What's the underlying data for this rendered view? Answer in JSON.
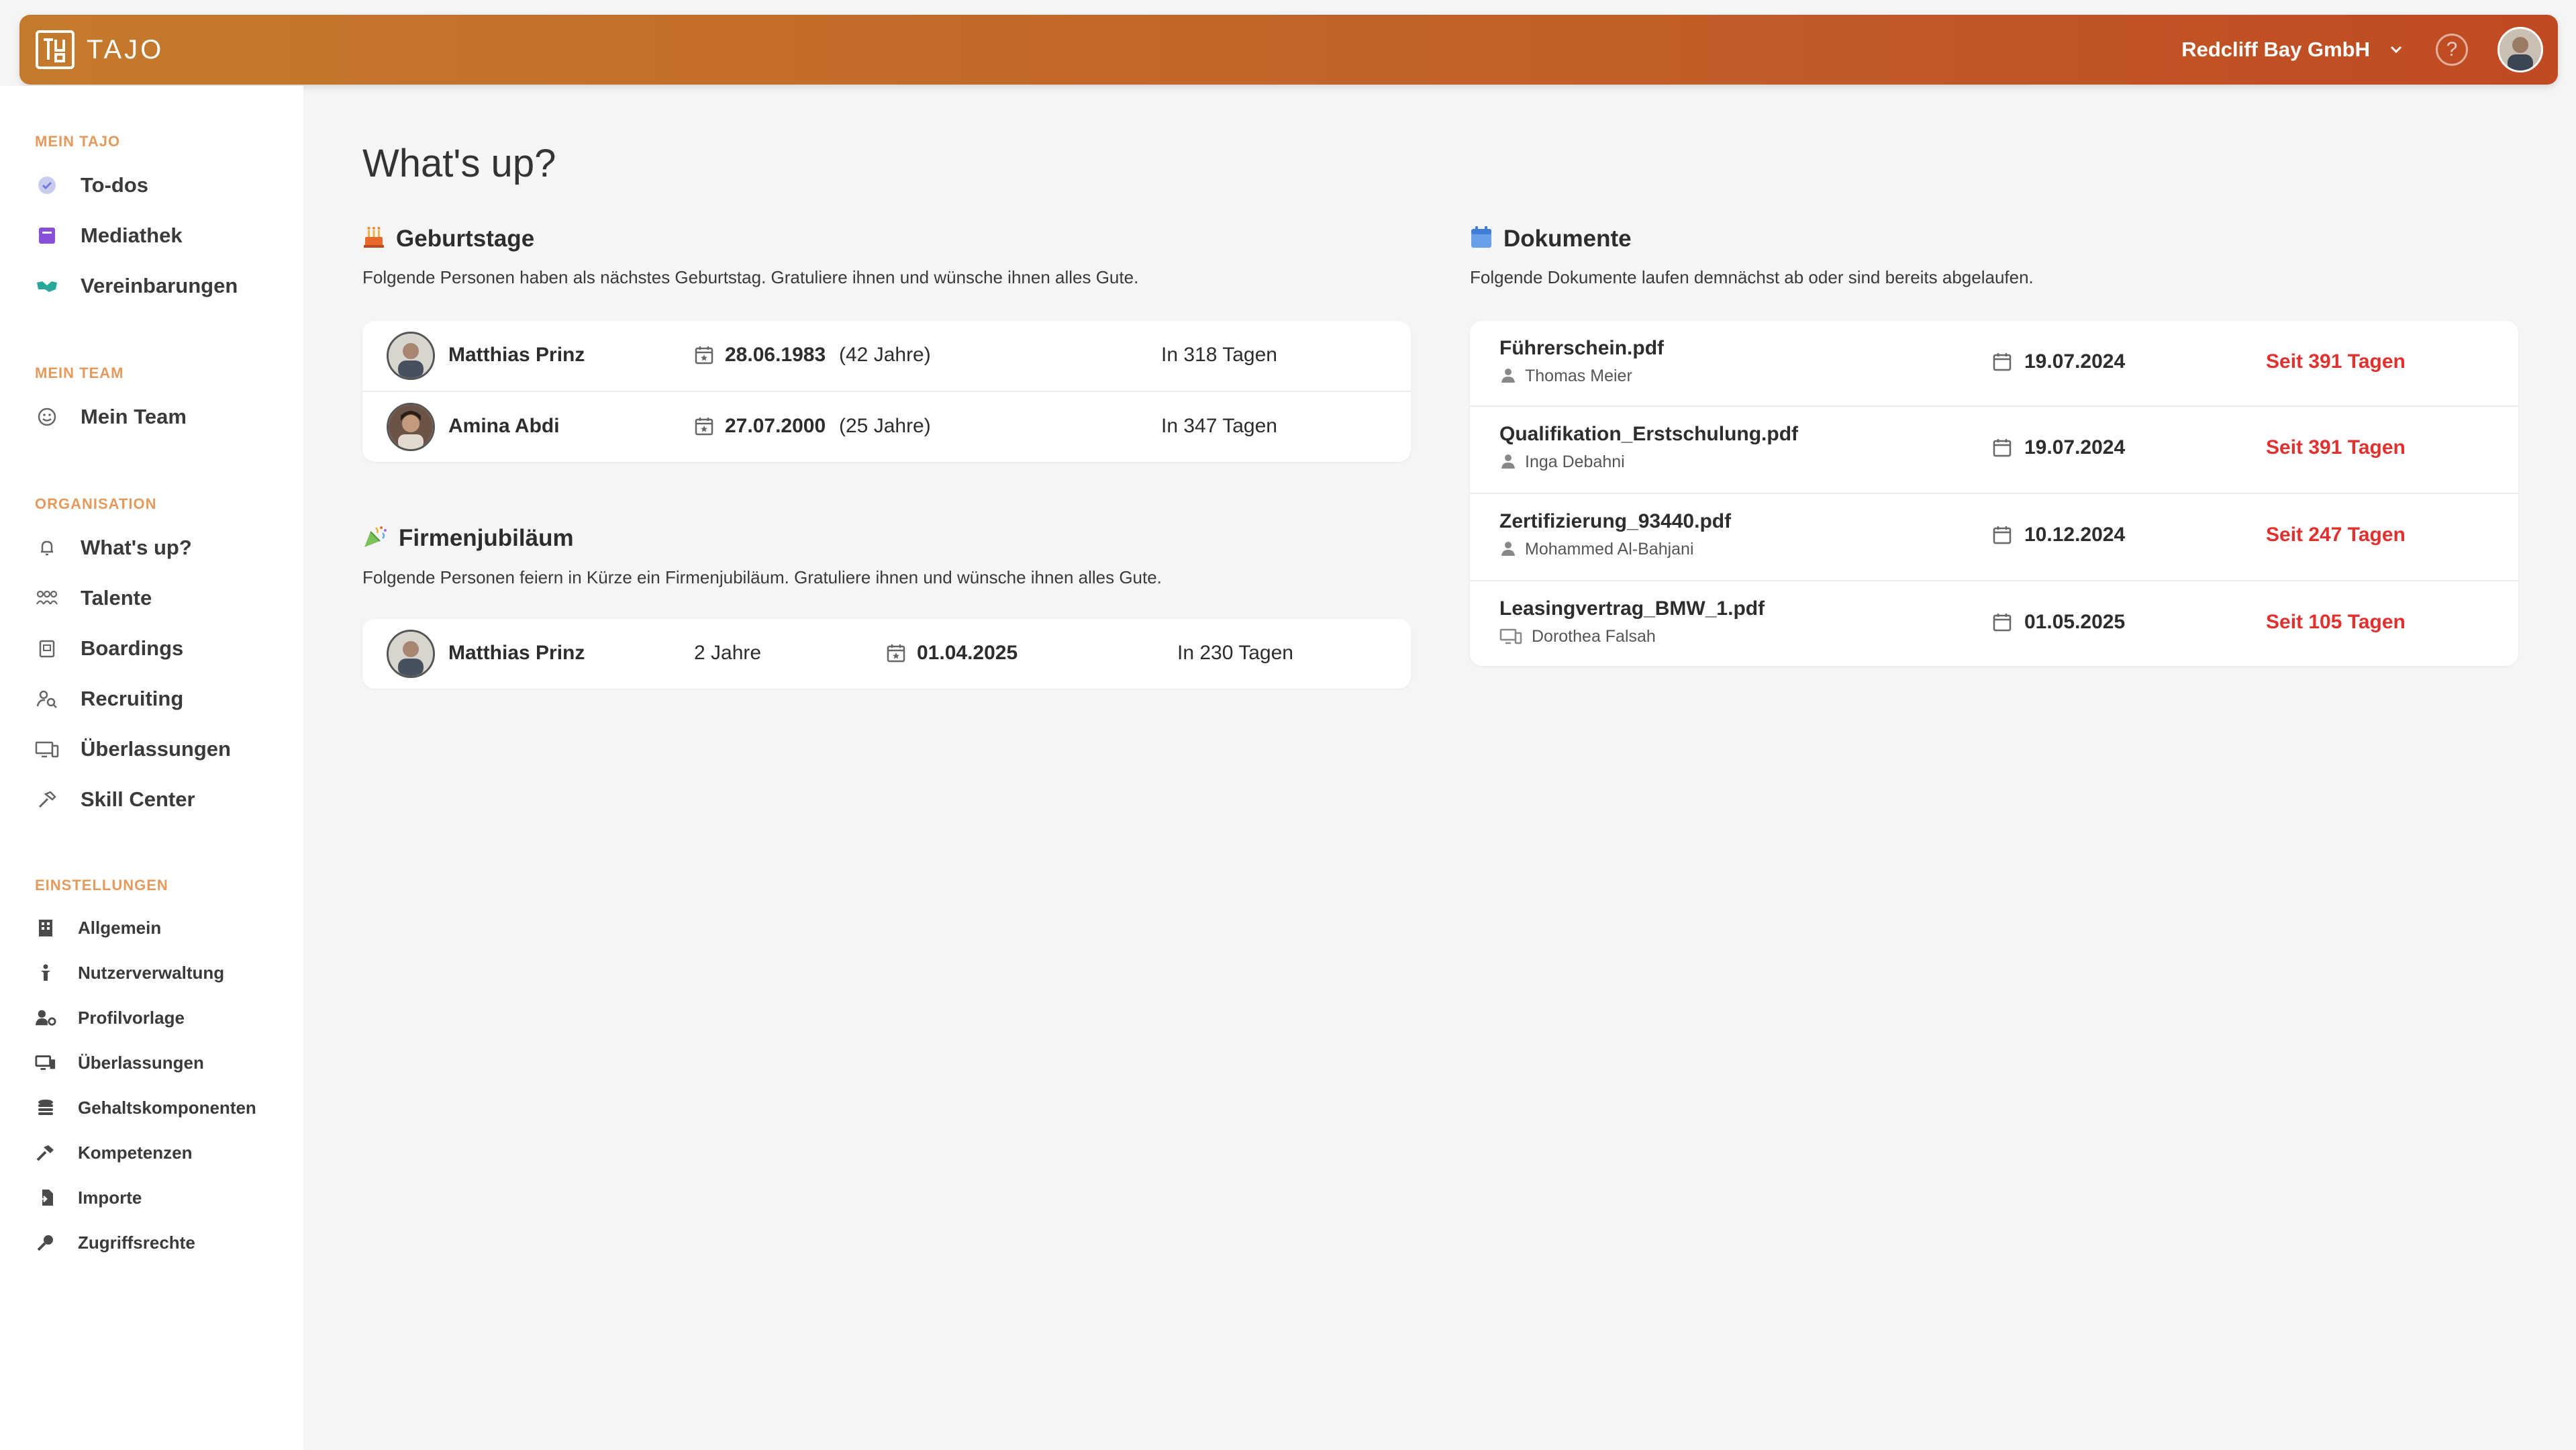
{
  "header": {
    "logo_text": "TAJO",
    "company": "Redcliff Bay GmbH",
    "help_symbol": "?",
    "accent": "#c2632a"
  },
  "sidebar": {
    "sections": [
      {
        "title": "MEIN TAJO",
        "items": [
          {
            "label": "To-dos",
            "icon": "check-circle-icon"
          },
          {
            "label": "Mediathek",
            "icon": "book-icon"
          },
          {
            "label": "Vereinbarungen",
            "icon": "handshake-icon"
          }
        ]
      },
      {
        "title": "MEIN TEAM",
        "items": [
          {
            "label": "Mein Team",
            "icon": "smile-icon"
          }
        ]
      },
      {
        "title": "ORGANISATION",
        "items": [
          {
            "label": "What's up?",
            "icon": "bell-icon"
          },
          {
            "label": "Talente",
            "icon": "people-icon"
          },
          {
            "label": "Boardings",
            "icon": "clipboard-icon"
          },
          {
            "label": "Recruiting",
            "icon": "user-search-icon"
          },
          {
            "label": "Überlassungen",
            "icon": "devices-icon"
          },
          {
            "label": "Skill Center",
            "icon": "hammer-icon"
          }
        ]
      },
      {
        "title": "EINSTELLUNGEN",
        "items": [
          {
            "label": "Allgemein",
            "icon": "building-icon"
          },
          {
            "label": "Nutzerverwaltung",
            "icon": "person-icon"
          },
          {
            "label": "Profilvorlage",
            "icon": "user-gear-icon"
          },
          {
            "label": "Überlassungen",
            "icon": "devices-icon"
          },
          {
            "label": "Gehaltskomponenten",
            "icon": "coins-icon"
          },
          {
            "label": "Kompetenzen",
            "icon": "hammer-icon"
          },
          {
            "label": "Importe",
            "icon": "import-icon"
          },
          {
            "label": "Zugriffsrechte",
            "icon": "key-icon"
          }
        ]
      }
    ]
  },
  "main": {
    "title": "What's up?",
    "birthdays": {
      "title": "Geburtstage",
      "icon": "cake-icon",
      "description": "Folgende Personen haben als nächstes Geburtstag. Gratuliere ihnen und wünsche ihnen alles Gute.",
      "rows": [
        {
          "name": "Matthias Prinz",
          "date": "28.06.1983",
          "age": "(42 Jahre)",
          "in": "In 318 Tagen"
        },
        {
          "name": "Amina Abdi",
          "date": "27.07.2000",
          "age": "(25 Jahre)",
          "in": "In 347 Tagen"
        }
      ]
    },
    "anniversary": {
      "title": "Firmenjubiläum",
      "icon": "party-popper-icon",
      "description": "Folgende Personen feiern in Kürze ein Firmenjubiläum. Gratuliere ihnen und wünsche ihnen alles Gute.",
      "rows": [
        {
          "name": "Matthias Prinz",
          "years": "2 Jahre",
          "date": "01.04.2025",
          "in": "In 230 Tagen"
        }
      ]
    },
    "documents": {
      "title": "Dokumente",
      "icon": "calendar-icon",
      "description": "Folgende Dokumente laufen demnächst ab oder sind bereits abgelaufen.",
      "rows": [
        {
          "file": "Führerschein.pdf",
          "owner": "Thomas Meier",
          "owner_icon": "person-icon",
          "date": "19.07.2024",
          "since": "Seit 391 Tagen"
        },
        {
          "file": "Qualifikation_Erstschulung.pdf",
          "owner": "Inga Debahni",
          "owner_icon": "person-icon",
          "date": "19.07.2024",
          "since": "Seit 391 Tagen"
        },
        {
          "file": "Zertifizierung_93440.pdf",
          "owner": "Mohammed Al-Bahjani",
          "owner_icon": "person-icon",
          "date": "10.12.2024",
          "since": "Seit 247 Tagen"
        },
        {
          "file": "Leasingvertrag_BMW_1.pdf",
          "owner": "Dorothea Falsah",
          "owner_icon": "devices-icon",
          "date": "01.05.2025",
          "since": "Seit 105 Tagen"
        }
      ]
    }
  }
}
